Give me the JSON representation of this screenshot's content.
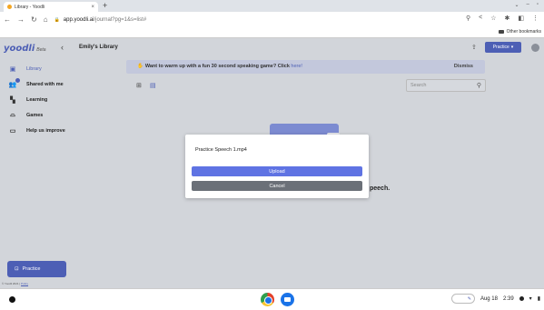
{
  "browser": {
    "tab_title": "Library - Yoodli",
    "tab_close": "×",
    "new_tab": "+",
    "url_host": "app.yoodli.ai",
    "url_path": "/journal?pg=1&s=list#",
    "other_bookmarks": "Other bookmarks"
  },
  "sidebar": {
    "logo": "yoodli",
    "logo_tag": "Beta",
    "items": [
      {
        "label": "Library",
        "icon": "library-icon"
      },
      {
        "label": "Shared with me",
        "icon": "shared-users-icon"
      },
      {
        "label": "Learning",
        "icon": "learning-grid-icon"
      },
      {
        "label": "Games",
        "icon": "games-icon"
      },
      {
        "label": "Help us improve",
        "icon": "feedback-icon"
      }
    ],
    "practice_label": "Practice",
    "footer_text": "© Yoodli 2021 |",
    "footer_link": "Policy"
  },
  "header": {
    "library_title": "Emily's Library",
    "practice_label": "Practice"
  },
  "banner": {
    "message": "Want to warm up with a fun 30 second speaking game? Click ",
    "link": "here!",
    "dismiss": "Dismiss"
  },
  "search": {
    "placeholder": "Search"
  },
  "main": {
    "empty_text": "peech."
  },
  "modal": {
    "file_name": "Practice Speech 1.mp4",
    "upload_label": "Upload",
    "cancel_label": "Cancel"
  },
  "shelf": {
    "date": "Aug 18",
    "time": "2:39"
  },
  "colors": {
    "accent": "#4d5fb5",
    "upload_button": "#5f73e3",
    "cancel_button": "#6b7078"
  }
}
